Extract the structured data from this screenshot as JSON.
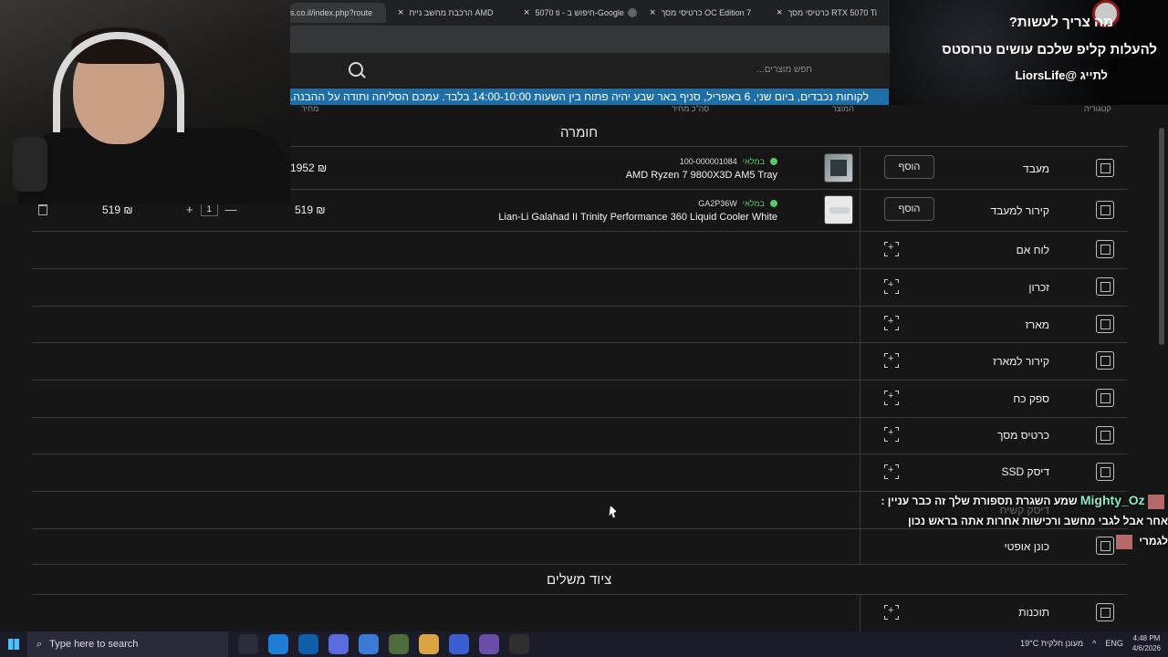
{
  "browser": {
    "tabs": [
      {
        "label": "s.co.il/index.php?route",
        "active": true
      },
      {
        "label": "הרכבת מחשב נייח AMD"
      },
      {
        "label": "5070 ti - חיפוש ב-Google"
      },
      {
        "label": "כרטיסי מסך OC Edition 7"
      },
      {
        "label": "כרטיסי מסך RTX 5070 Ti"
      }
    ],
    "close_glyph": "×"
  },
  "site": {
    "search_placeholder": "חפש מוצרים...",
    "announcement": "לקוחות נכבדים, ביום שני, 6 באפריל, סניף באר שבע יהיה פתוח בין השעות 14:00-10:00 בלבד. עמכם הסליחה ותודה על ההבנה.",
    "column_headers": {
      "category": "קטגוריה",
      "product": "המוצר",
      "price": "סה\"כ מחיר",
      "cart": "מחיר"
    }
  },
  "sections": {
    "hardware": "חומרה",
    "peripherals": "ציוד משלים"
  },
  "categories": [
    {
      "label": "מעבד",
      "icon": "cpu-icon"
    },
    {
      "label": "קירור למעבד",
      "icon": "fan-icon"
    },
    {
      "label": "לוח אם",
      "icon": "motherboard-icon"
    },
    {
      "label": "זכרון",
      "icon": "ram-icon"
    },
    {
      "label": "מארז",
      "icon": "case-icon"
    },
    {
      "label": "קירור למארז",
      "icon": "case-fan-icon"
    },
    {
      "label": "ספק כח",
      "icon": "psu-icon"
    },
    {
      "label": "כרטיס מסך",
      "icon": "gpu-icon"
    },
    {
      "label": "דיסק SSD",
      "icon": "ssd-icon"
    },
    {
      "label": "דיסק קשיח",
      "icon": "hdd-icon"
    },
    {
      "label": "כונן אופטי",
      "icon": "optical-drive-icon"
    },
    {
      "label": "תוכנות",
      "icon": "software-icon"
    }
  ],
  "add_label": "הוסף",
  "products": [
    {
      "sku": "100-000001084",
      "stock": "במלאי",
      "name": "AMD Ryzen 7 9800X3D AM5 Tray",
      "price": "1952 ₪"
    },
    {
      "sku": "GA2P36W",
      "stock": "במלאי",
      "name": "Lian-Li Galahad II Trinity Performance 360 Liquid Cooler White",
      "price": "519 ₪",
      "qty": "1",
      "total": "519 ₪"
    }
  ],
  "qty_controls": {
    "plus": "+",
    "minus": "—"
  },
  "overlay": {
    "question": "מה צריך לעשות?",
    "line1": "להעלות קליפ שלכם עושים טרוסטס",
    "line2": "לתייג @LiorsLife",
    "chat_user": "Mighty_Oz",
    "chat_line1": "שמע השגרת תספורת שלך זה כבר עניין :",
    "chat_line2": "אחר אבל לגבי מחשב ורכישות אחרות אתה בראש נכון",
    "chat_line3": "לגמרי"
  },
  "taskbar": {
    "search_text": "Type here to search",
    "weather": "19°C  מעונן חלקית",
    "lang": "ENG",
    "time": "4:48 PM",
    "date": "4/6/2026"
  }
}
